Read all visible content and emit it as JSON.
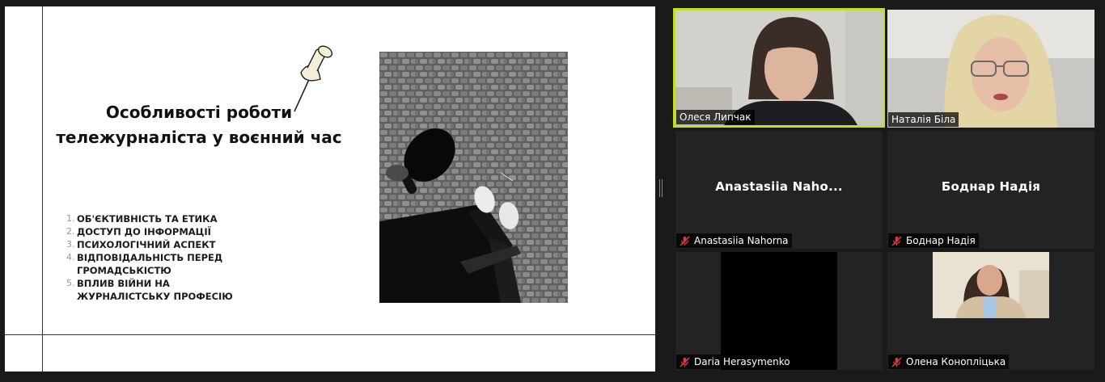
{
  "slide": {
    "title": "Особливості роботи тележурналіста у воєнний час",
    "topics": [
      {
        "num": "1.",
        "text": "ОБ'ЄКТИВНІСТЬ ТА ЕТИКА"
      },
      {
        "num": "2.",
        "text": "ДОСТУП ДО ІНФОРМАЦІЇ"
      },
      {
        "num": "3.",
        "text": "ПСИХОЛОГІЧНИЙ АСПЕКТ"
      },
      {
        "num": "4.",
        "text": "ВІДПОВІДАЛЬНІСТЬ ПЕРЕД ГРОМАДСЬКІСТЮ"
      },
      {
        "num": "5.",
        "text": "ВПЛИВ ВІЙНИ НА ЖУРНАЛІСТСЬКУ ПРОФЕСІЮ"
      }
    ]
  },
  "participants": [
    {
      "name": "Олеся Липчак",
      "muted": false,
      "video": true,
      "active": true
    },
    {
      "name": "Наталія Біла",
      "muted": false,
      "video": true,
      "active": false
    },
    {
      "name": "Anastasiia Nahorna",
      "display_name": "Anastasiia  Naho...",
      "muted": true,
      "video": false
    },
    {
      "name": "Боднар Надія",
      "display_name": "Боднар Надія",
      "muted": true,
      "video": false
    },
    {
      "name": "Daria Herasymenko",
      "muted": true,
      "video": true
    },
    {
      "name": "Олена Конопліцька",
      "muted": true,
      "video": true
    }
  ],
  "colors": {
    "active_border": "#c4df2b",
    "muted_icon": "#e0353a",
    "tile_bg": "#232323"
  }
}
